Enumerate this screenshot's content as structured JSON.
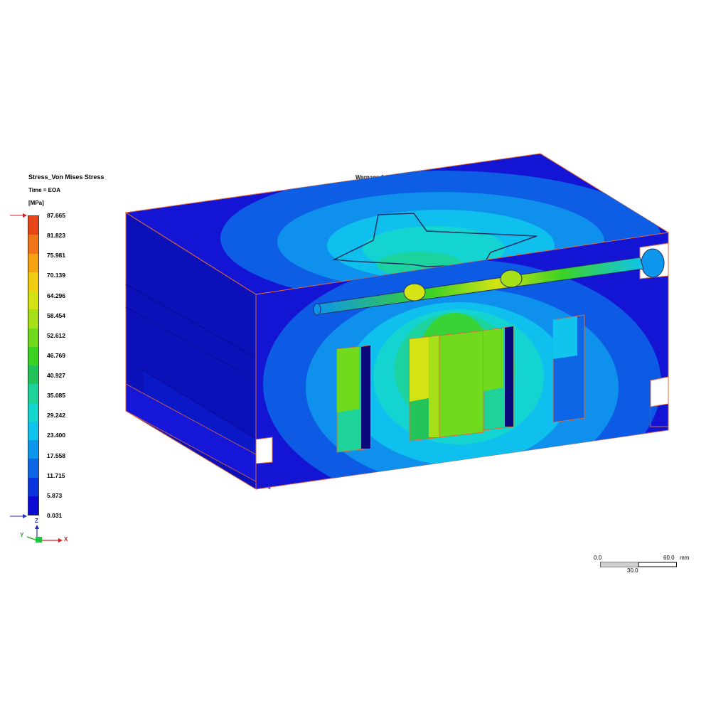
{
  "legend": {
    "title": "Stress_Von Mises Stress",
    "time": "Time = EOA",
    "unit": "[MPa]",
    "ticks": [
      "87.665",
      "81.823",
      "75.981",
      "70.139",
      "64.296",
      "58.454",
      "52.612",
      "46.769",
      "40.927",
      "35.085",
      "29.242",
      "23.400",
      "17.558",
      "11.715",
      "5.873",
      "0.031"
    ],
    "colors": [
      "#e8451a",
      "#f07418",
      "#f5a213",
      "#f2cc12",
      "#d4e314",
      "#a6e018",
      "#72da1c",
      "#3cd224",
      "#22c45a",
      "#1ed39a",
      "#14d6cc",
      "#10c4ee",
      "#0e96ec",
      "#0c66e6",
      "#0a34dc",
      "#0a0ad2"
    ]
  },
  "warpage_label": "Warpage  1.00 ×  0.000",
  "scale_bar": {
    "left": "0.0",
    "right": "60.0",
    "unit": "mm",
    "mid": "30.0"
  },
  "triad": {
    "z": "Z",
    "y": "Y",
    "x": "X"
  },
  "colors": {
    "base_blue": "#1010d4",
    "edge_orange": "#e06a3a",
    "dark_blue": "#0a0ab0"
  }
}
